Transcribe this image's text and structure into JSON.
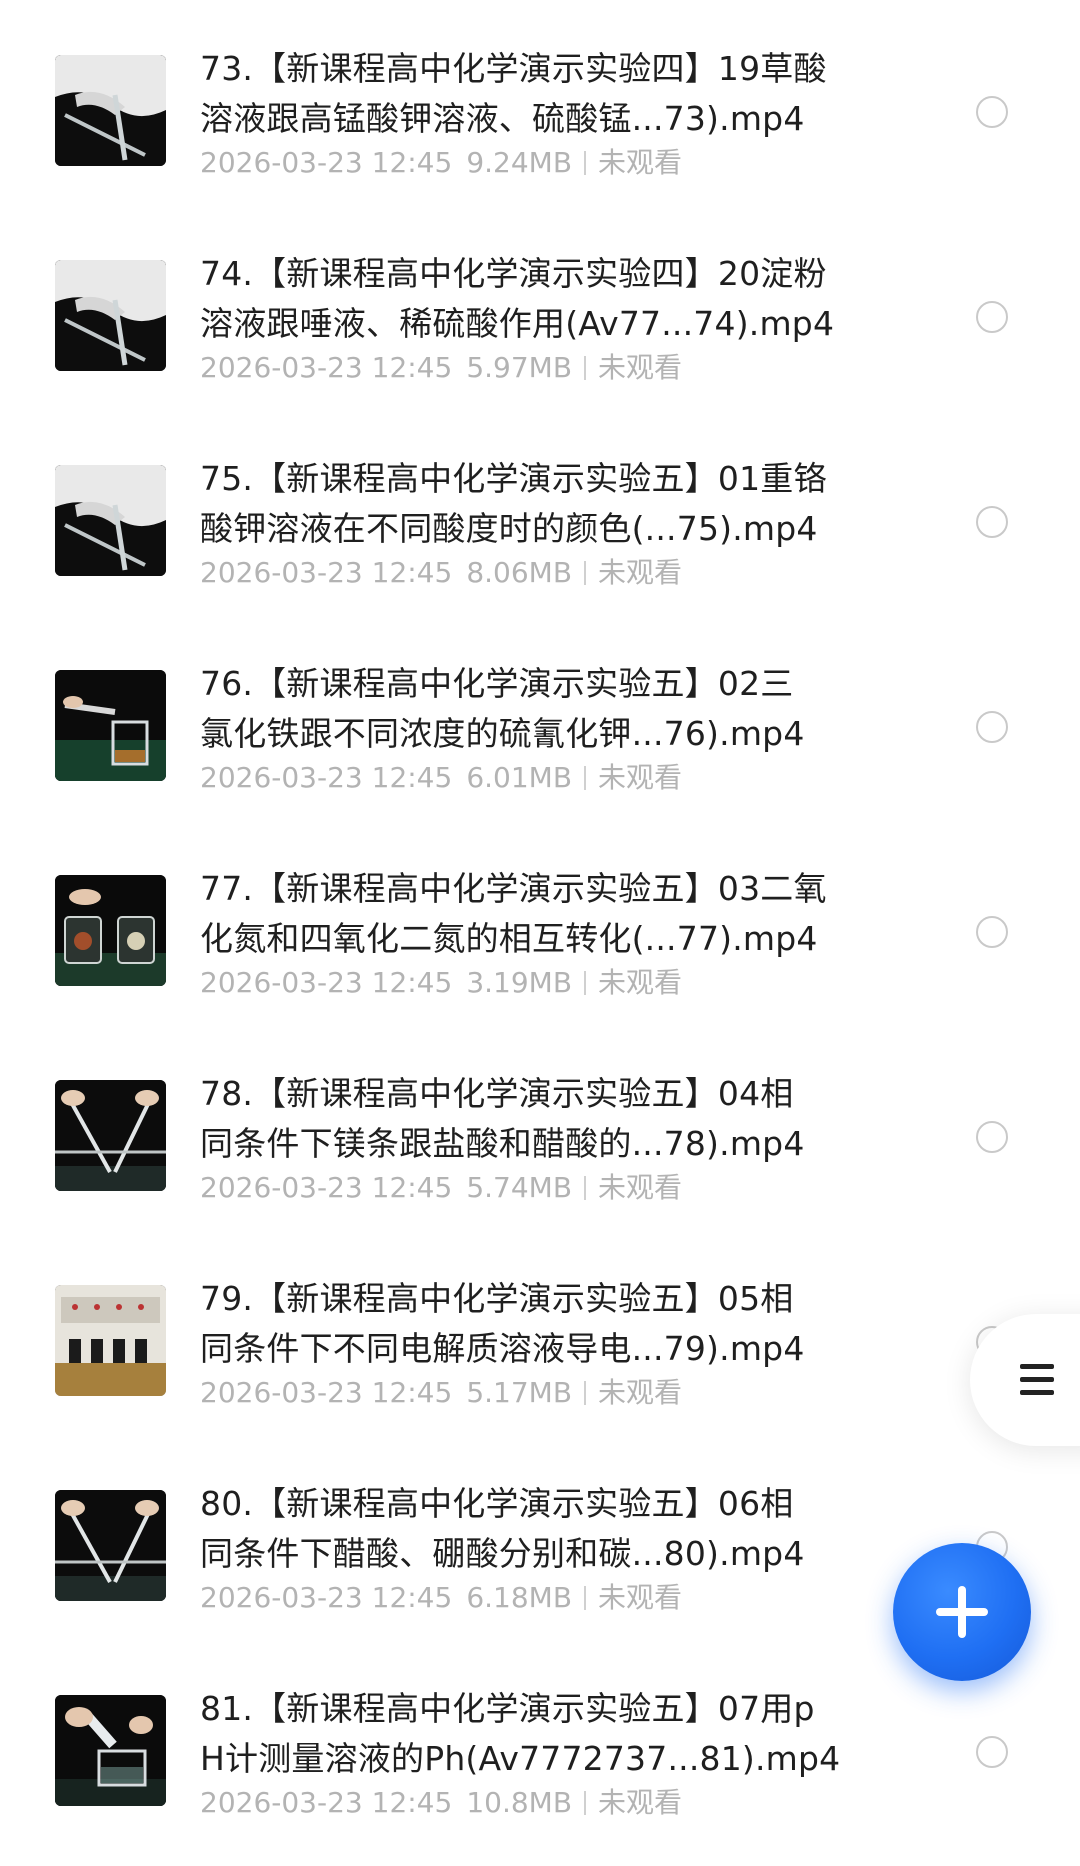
{
  "files": [
    {
      "line1": "73.【新课程高中化学演示实验四】19草酸",
      "line2": "溶液跟高锰酸钾溶液、硫酸锰...73).mp4",
      "date": "2026-03-23 12:45",
      "size": "9.24MB",
      "status": "未观看",
      "thumb": "hands-white"
    },
    {
      "line1": "74.【新课程高中化学演示实验四】20淀粉",
      "line2": "溶液跟唾液、稀硫酸作用(Av77...74).mp4",
      "date": "2026-03-23 12:45",
      "size": "5.97MB",
      "status": "未观看",
      "thumb": "hands-white"
    },
    {
      "line1": "75.【新课程高中化学演示实验五】01重铬",
      "line2": "酸钾溶液在不同酸度时的颜色(...75).mp4",
      "date": "2026-03-23 12:45",
      "size": "8.06MB",
      "status": "未观看",
      "thumb": "hands-white"
    },
    {
      "line1": "76.【新课程高中化学演示实验五】02三",
      "line2": "氯化铁跟不同浓度的硫氰化钾...76).mp4",
      "date": "2026-03-23 12:45",
      "size": "6.01MB",
      "status": "未观看",
      "thumb": "beaker-green"
    },
    {
      "line1": "77.【新课程高中化学演示实验五】03二氧",
      "line2": "化氮和四氧化二氮的相互转化(...77).mp4",
      "date": "2026-03-23 12:45",
      "size": "3.19MB",
      "status": "未观看",
      "thumb": "two-jars"
    },
    {
      "line1": "78.【新课程高中化学演示实验五】04相",
      "line2": "同条件下镁条跟盐酸和醋酸的...78).mp4",
      "date": "2026-03-23 12:45",
      "size": "5.74MB",
      "status": "未观看",
      "thumb": "tubes-rack"
    },
    {
      "line1": "79.【新课程高中化学演示实验五】05相",
      "line2": "同条件下不同电解质溶液导电...79).mp4",
      "date": "2026-03-23 12:45",
      "size": "5.17MB",
      "status": "未观看",
      "thumb": "conductivity"
    },
    {
      "line1": "80.【新课程高中化学演示实验五】06相",
      "line2": "同条件下醋酸、硼酸分别和碳...80).mp4",
      "date": "2026-03-23 12:45",
      "size": "6.18MB",
      "status": "未观看",
      "thumb": "tubes-rack"
    },
    {
      "line1": "81.【新课程高中化学演示实验五】07用p",
      "line2": "H计测量溶液的Ph(Av7772737...81).mp4",
      "date": "2026-03-23 12:45",
      "size": "10.8MB",
      "status": "未观看",
      "thumb": "pour-beaker"
    }
  ],
  "icons": {
    "menu": "hamburger-menu-icon",
    "add": "plus-icon",
    "select": "radio-circle-icon"
  },
  "colors": {
    "fab": "#1f6ff3",
    "title_text": "#1f1f1f",
    "meta_text": "#b3b3b3"
  }
}
